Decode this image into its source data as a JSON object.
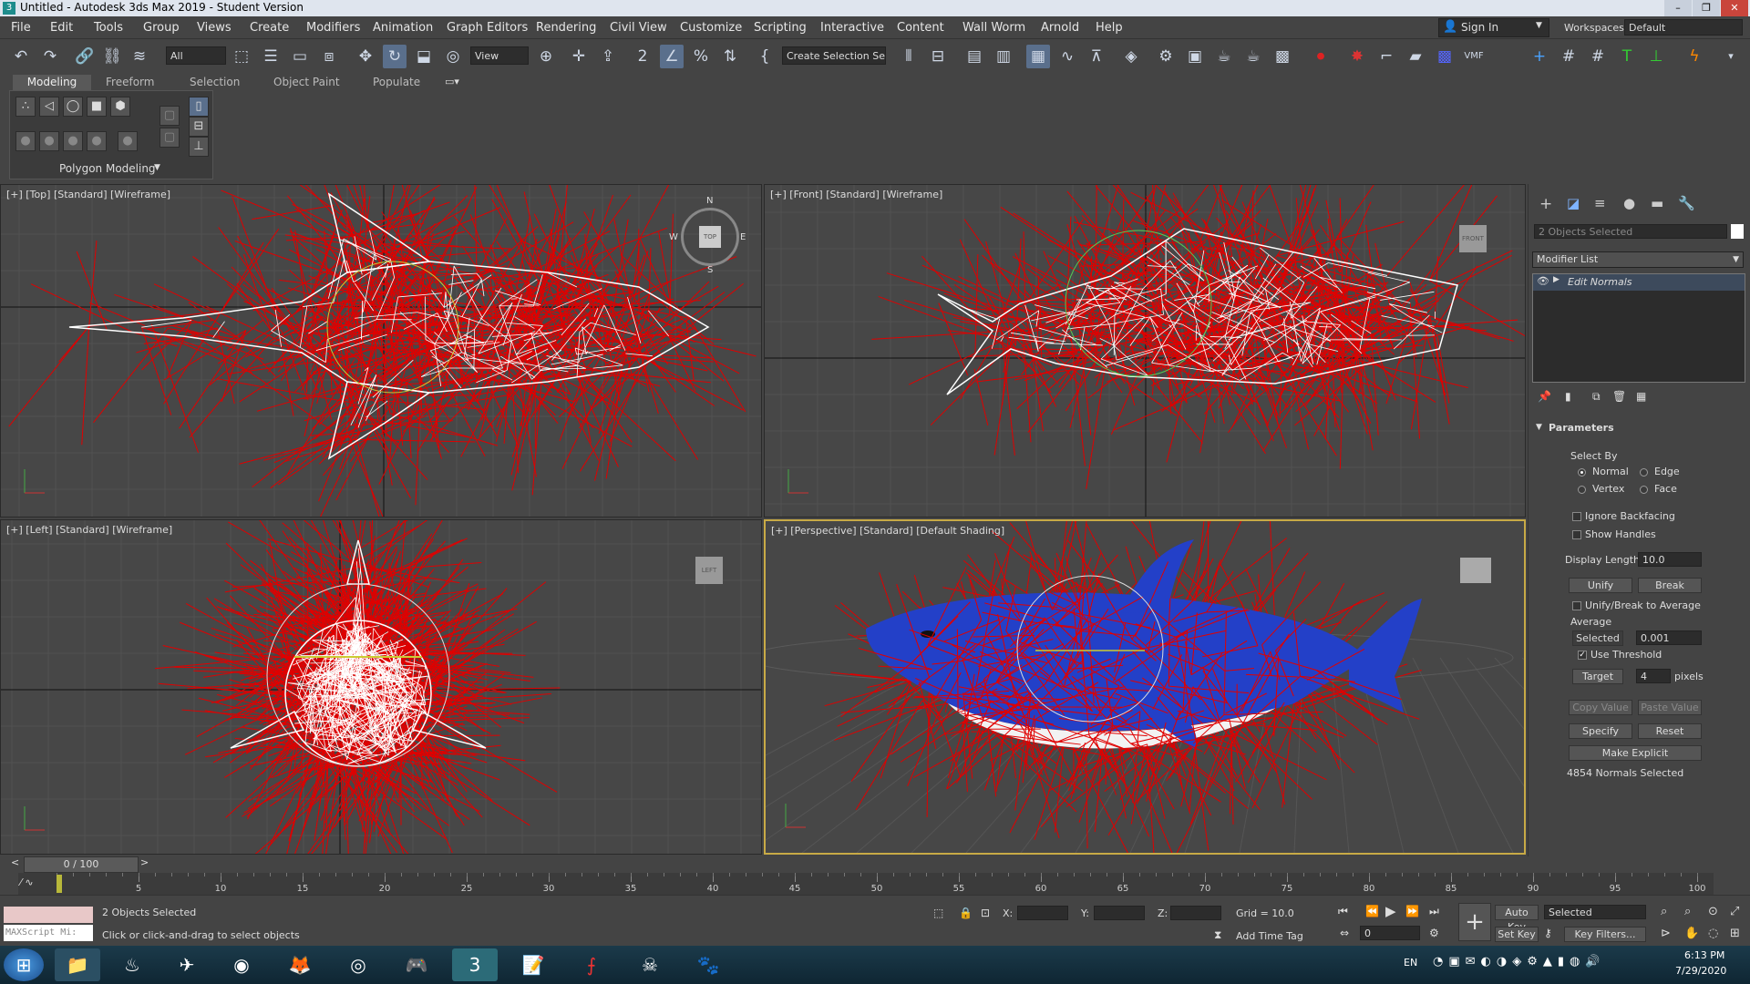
{
  "window": {
    "title": "Untitled - Autodesk 3ds Max 2019 - Student Version",
    "minimize": "–",
    "restore": "❐",
    "close": "✕"
  },
  "menus": [
    "File",
    "Edit",
    "Tools",
    "Group",
    "Views",
    "Create",
    "Modifiers",
    "Animation",
    "Graph Editors",
    "Rendering",
    "Civil View",
    "Customize",
    "Scripting",
    "Interactive",
    "Content",
    "Wall Worm",
    "Arnold",
    "Help"
  ],
  "account": {
    "sign_in": "Sign In",
    "workspaces_label": "Workspaces:",
    "workspace": "Default"
  },
  "toolbar": {
    "filter": "All",
    "ref_coord": "View",
    "selection_set": "Create Selection Se"
  },
  "ribbon": {
    "tabs": [
      "Modeling",
      "Freeform",
      "Selection",
      "Object Paint",
      "Populate"
    ],
    "panel_title": "Polygon Modeling"
  },
  "viewports": {
    "top": "[+] [Top] [Standard] [Wireframe]",
    "front": "[+] [Front] [Standard] [Wireframe]",
    "left": "[+] [Left] [Standard] [Wireframe]",
    "perspective": "[+] [Perspective] [Standard] [Default Shading]",
    "compass": {
      "n": "N",
      "s": "S",
      "e": "E",
      "w": "W",
      "top": "TOP"
    },
    "viewcube_front": "FRONT",
    "viewcube_left": "LEFT"
  },
  "command_panel": {
    "objects_selected": "2 Objects Selected",
    "modifier_list": "Modifier List",
    "modifier": "Edit Normals",
    "rollout_title": "Parameters",
    "select_by_label": "Select By",
    "select_by": {
      "normal": "Normal",
      "edge": "Edge",
      "vertex": "Vertex",
      "face": "Face",
      "selected": "Normal"
    },
    "ignore_backfacing": "Ignore Backfacing",
    "show_handles": "Show Handles",
    "display_length_label": "Display Length:",
    "display_length": "10.0",
    "unify": "Unify",
    "break": "Break",
    "unify_break_avg": "Unify/Break to Average",
    "average_label": "Average",
    "selected_btn": "Selected",
    "selected_value": "0.001",
    "use_threshold": "Use Threshold",
    "target_btn": "Target",
    "target_value": "4",
    "pixels": "pixels",
    "copy_value": "Copy Value",
    "paste_value": "Paste Value",
    "specify": "Specify",
    "reset": "Reset",
    "make_explicit": "Make Explicit",
    "normals_selected": "4854 Normals Selected"
  },
  "timeline": {
    "frame_display": "0 / 100",
    "ticks": [
      "5",
      "10",
      "15",
      "20",
      "25",
      "30",
      "35",
      "40",
      "45",
      "50",
      "55",
      "60",
      "65",
      "70",
      "75",
      "80",
      "85",
      "90",
      "95",
      "100"
    ],
    "current_frame": 0
  },
  "status": {
    "maxscript": "MAXScript Mi:",
    "selected_count": "2 Objects Selected",
    "prompt": "Click or click-and-drag to select objects",
    "x_label": "X:",
    "y_label": "Y:",
    "z_label": "Z:",
    "grid": "Grid = 10.0",
    "add_time_tag": "Add Time Tag",
    "auto_key": "Auto Key",
    "set_key": "Set Key",
    "key_mode": "Selected",
    "key_filters": "Key Filters...",
    "frame_field": "0"
  },
  "taskbar": {
    "language": "EN",
    "time": "6:13 PM",
    "date": "7/29/2020"
  },
  "colors": {
    "accent": "#5a6f8c",
    "normals": "#e00000",
    "wireframe": "#ffffff",
    "shark_blue": "#2340c8",
    "active_border": "#c8aa46"
  }
}
